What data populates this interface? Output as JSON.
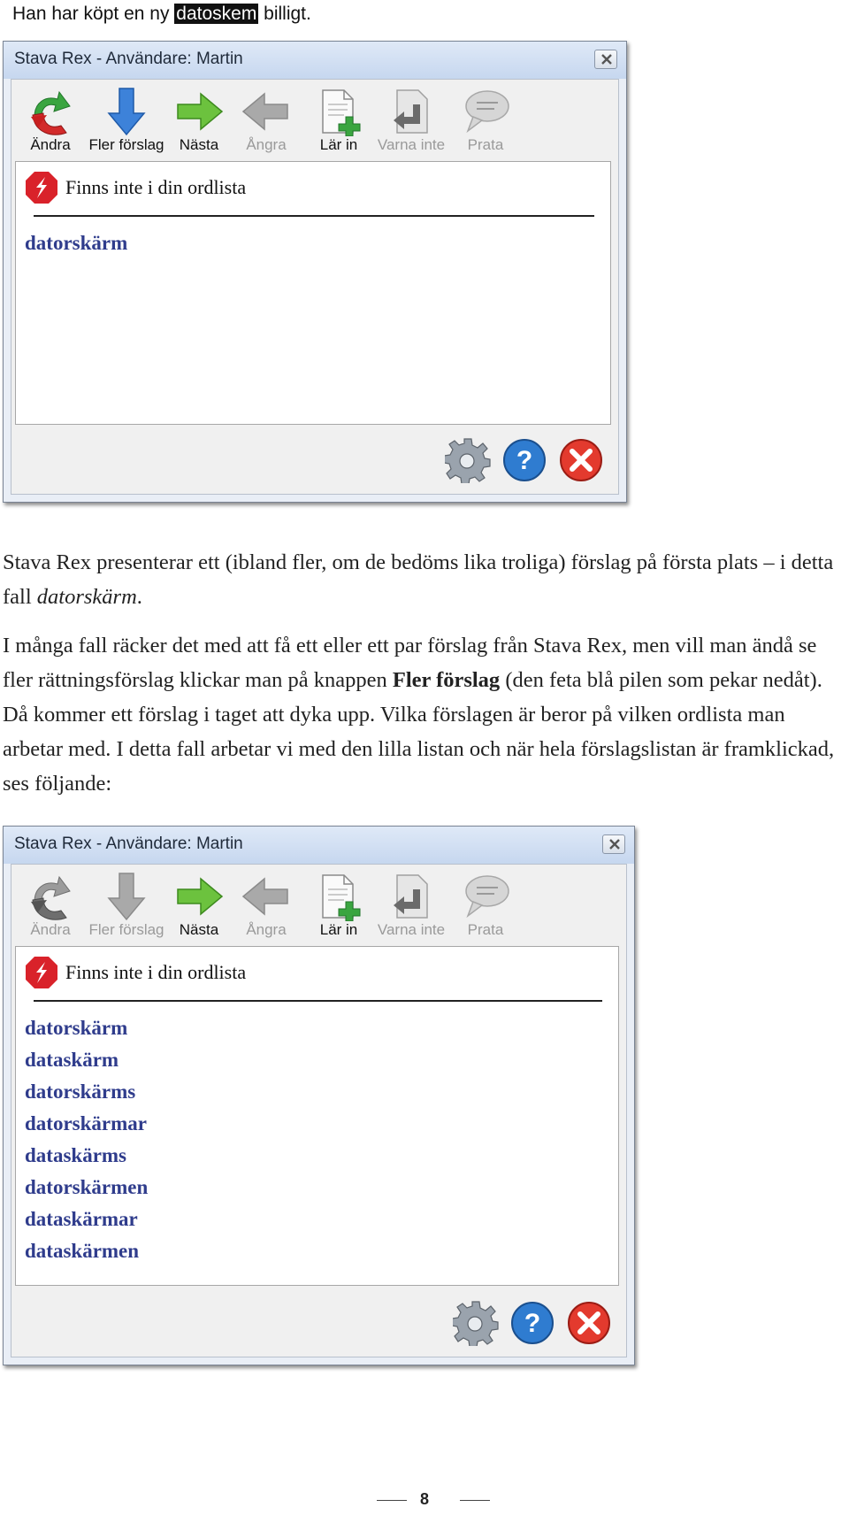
{
  "intro": {
    "before": "Han har köpt en ny ",
    "highlight": "datoskem",
    "after": " billigt."
  },
  "window1": {
    "title": "Stava Rex - Användare: Martin",
    "toolbar": [
      {
        "label": "Ändra",
        "icon": "change-icon",
        "enabled": true
      },
      {
        "label": "Fler förslag",
        "icon": "down-arrow-icon",
        "enabled": true
      },
      {
        "label": "Nästa",
        "icon": "right-arrow-icon",
        "enabled": true
      },
      {
        "label": "Ångra",
        "icon": "left-arrow-icon",
        "enabled": false
      },
      {
        "label": "Lär in",
        "icon": "document-add-icon",
        "enabled": true
      },
      {
        "label": "Varna inte",
        "icon": "document-back-icon",
        "enabled": false
      },
      {
        "label": "Prata",
        "icon": "speech-bubble-icon",
        "enabled": false
      }
    ],
    "status": "Finns inte i din ordlista",
    "suggestions": [
      "datorskärm"
    ]
  },
  "paragraph1": {
    "text": "Stava Rex presenterar ett (ibland fler, om de bedöms lika troliga) förslag på första plats – i detta fall ",
    "italic": "datorskärm",
    "end": "."
  },
  "paragraph2": {
    "before": "I många fall räcker det med att få ett eller ett par förslag från Stava Rex, men vill man ändå se fler rättningsförslag klickar man på knappen ",
    "bold": "Fler förslag",
    "after": " (den feta blå pilen som pekar nedåt). Då kommer ett förslag i taget att dyka upp. Vilka förslagen är beror på vilken ordlista man arbetar med. I detta fall arbetar vi med den lilla listan och när hela förslagslistan är framklickad, ses följande:"
  },
  "window2": {
    "title": "Stava Rex - Användare: Martin",
    "toolbar": [
      {
        "label": "Ändra",
        "icon": "change-icon",
        "enabled": false
      },
      {
        "label": "Fler förslag",
        "icon": "down-arrow-icon",
        "enabled": false
      },
      {
        "label": "Nästa",
        "icon": "right-arrow-icon",
        "enabled": true
      },
      {
        "label": "Ångra",
        "icon": "left-arrow-icon",
        "enabled": false
      },
      {
        "label": "Lär in",
        "icon": "document-add-icon",
        "enabled": true
      },
      {
        "label": "Varna inte",
        "icon": "document-back-icon",
        "enabled": false
      },
      {
        "label": "Prata",
        "icon": "speech-bubble-icon",
        "enabled": false
      }
    ],
    "status": "Finns inte i din ordlista",
    "suggestions": [
      "datorskärm",
      "dataskärm",
      "datorskärms",
      "datorskärmar",
      "dataskärms",
      "datorskärmen",
      "dataskärmar",
      "dataskärmen"
    ]
  },
  "page_number": "8",
  "colors": {
    "suggestion": "#2f3c8c",
    "title_gradient_top": "#dfe9f7",
    "title_gradient_bottom": "#c6d7ef",
    "stop_red": "#d9222a"
  }
}
